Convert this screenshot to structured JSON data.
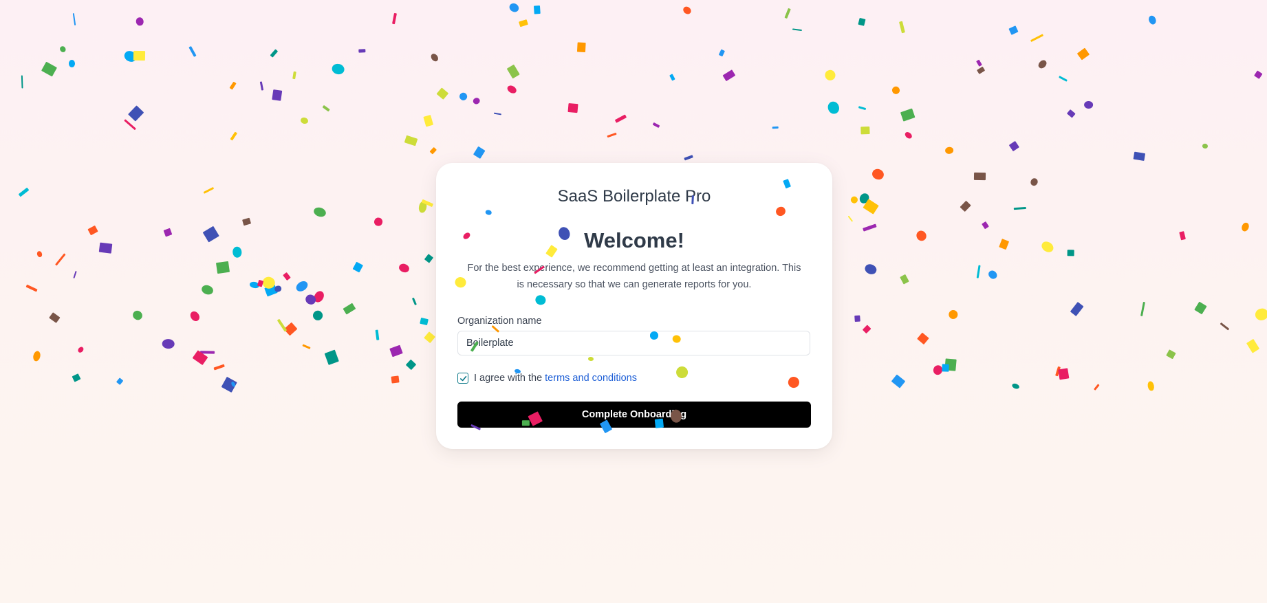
{
  "app": {
    "title": "SaaS Boilerplate Pro"
  },
  "onboarding": {
    "heading": "Welcome!",
    "intro": "For the best experience, we recommend getting at least an integration. This is necessary so that we can generate reports for you.",
    "org_label": "Organization name",
    "org_value": "Boilerplate",
    "agree_checked": true,
    "agree_text": "I agree with the",
    "terms_link": "terms and conditions",
    "submit_label": "Complete Onboarding"
  },
  "decor": {
    "confetti_palette": [
      "#e91e63",
      "#9c27b0",
      "#673ab7",
      "#3f51b5",
      "#2196f3",
      "#03a9f4",
      "#00bcd4",
      "#009688",
      "#4caf50",
      "#8bc34a",
      "#cddc39",
      "#ffeb3b",
      "#ffc107",
      "#ff9800",
      "#ff5722",
      "#795548"
    ]
  }
}
